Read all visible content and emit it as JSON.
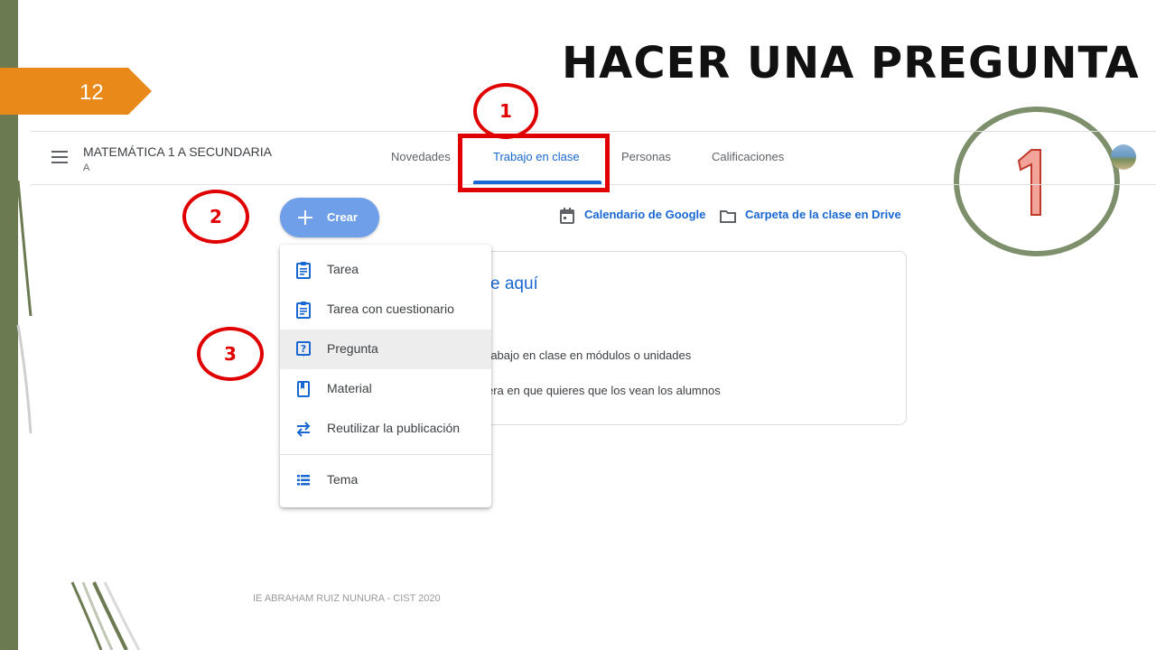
{
  "slide": {
    "page_number": "12",
    "title": "HACER UNA PREGUNTA",
    "footer": "IE ABRAHAM RUIZ NUNURA - CIST 2020",
    "big_step_number": "1"
  },
  "header": {
    "class_name": "MATEMÁTICA 1 A SECUNDARIA",
    "class_section": "A",
    "tabs": [
      {
        "label": "Novedades"
      },
      {
        "label": "Trabajo en clase"
      },
      {
        "label": "Personas"
      },
      {
        "label": "Calificaciones"
      }
    ]
  },
  "annotations": {
    "step1": "1",
    "step2": "2",
    "step3": "3"
  },
  "toolbar": {
    "create_label": "Crear",
    "calendar_link": "Calendario de Google",
    "drive_link": "Carpeta de la clase en Drive"
  },
  "card": {
    "title": "e aquí",
    "line1": "rabajo en clase en módulos o unidades",
    "line2": "era en que quieres que los vean los alumnos"
  },
  "create_menu": {
    "items": [
      {
        "label": "Tarea",
        "icon": "assignment-icon"
      },
      {
        "label": "Tarea con cuestionario",
        "icon": "quiz-assignment-icon"
      },
      {
        "label": "Pregunta",
        "icon": "question-icon"
      },
      {
        "label": "Material",
        "icon": "material-icon"
      },
      {
        "label": "Reutilizar la publicación",
        "icon": "reuse-icon"
      },
      {
        "label": "Tema",
        "icon": "topic-icon"
      }
    ]
  },
  "colors": {
    "accent_blue": "#1967d2",
    "create_button": "#6f9fe8",
    "annotation_red": "#e00000",
    "slide_green": "#6b7a50",
    "tag_orange": "#e8891a"
  }
}
